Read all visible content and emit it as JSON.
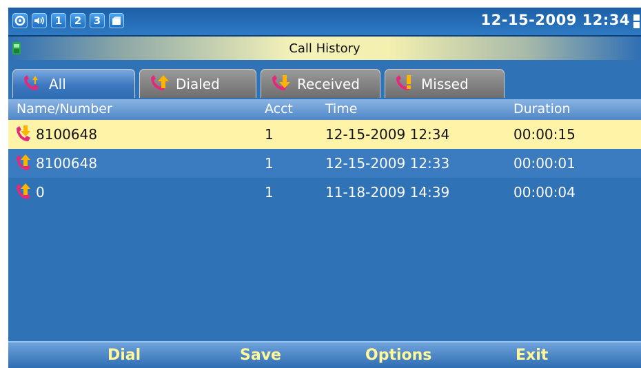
{
  "status_bar": {
    "icons": [
      "refresh-icon",
      "volume-icon",
      "1",
      "2",
      "3",
      "card-icon"
    ],
    "datetime": "12-15-2009 12:34"
  },
  "title_bar": {
    "title": "Call History"
  },
  "tabs": [
    {
      "label": "All",
      "icon": "all-calls-icon",
      "active": true
    },
    {
      "label": "Dialed",
      "icon": "dialed-call-icon",
      "active": false
    },
    {
      "label": "Received",
      "icon": "received-call-icon",
      "active": false
    },
    {
      "label": "Missed",
      "icon": "missed-call-icon",
      "active": false
    }
  ],
  "table": {
    "headers": {
      "name": "Name/Number",
      "acct": "Acct",
      "time": "Time",
      "duration": "Duration"
    },
    "rows": [
      {
        "type": "received",
        "icon": "received-call-icon",
        "number": "8100648",
        "acct": "1",
        "time": "12-15-2009 12:34",
        "duration": "00:00:15",
        "selected": true
      },
      {
        "type": "dialed",
        "icon": "dialed-call-icon",
        "number": "8100648",
        "acct": "1",
        "time": "12-15-2009 12:33",
        "duration": "00:00:01",
        "selected": false
      },
      {
        "type": "dialed",
        "icon": "dialed-call-icon",
        "number": "0",
        "acct": "1",
        "time": "11-18-2009 14:39",
        "duration": "00:00:04",
        "selected": false
      }
    ]
  },
  "softkeys": {
    "dial": "Dial",
    "save": "Save",
    "options": "Options",
    "exit": "Exit"
  },
  "colors": {
    "screen_bg": "#2f72b6",
    "selected_row": "#fff3a8",
    "softkey_text": "#fff799"
  }
}
